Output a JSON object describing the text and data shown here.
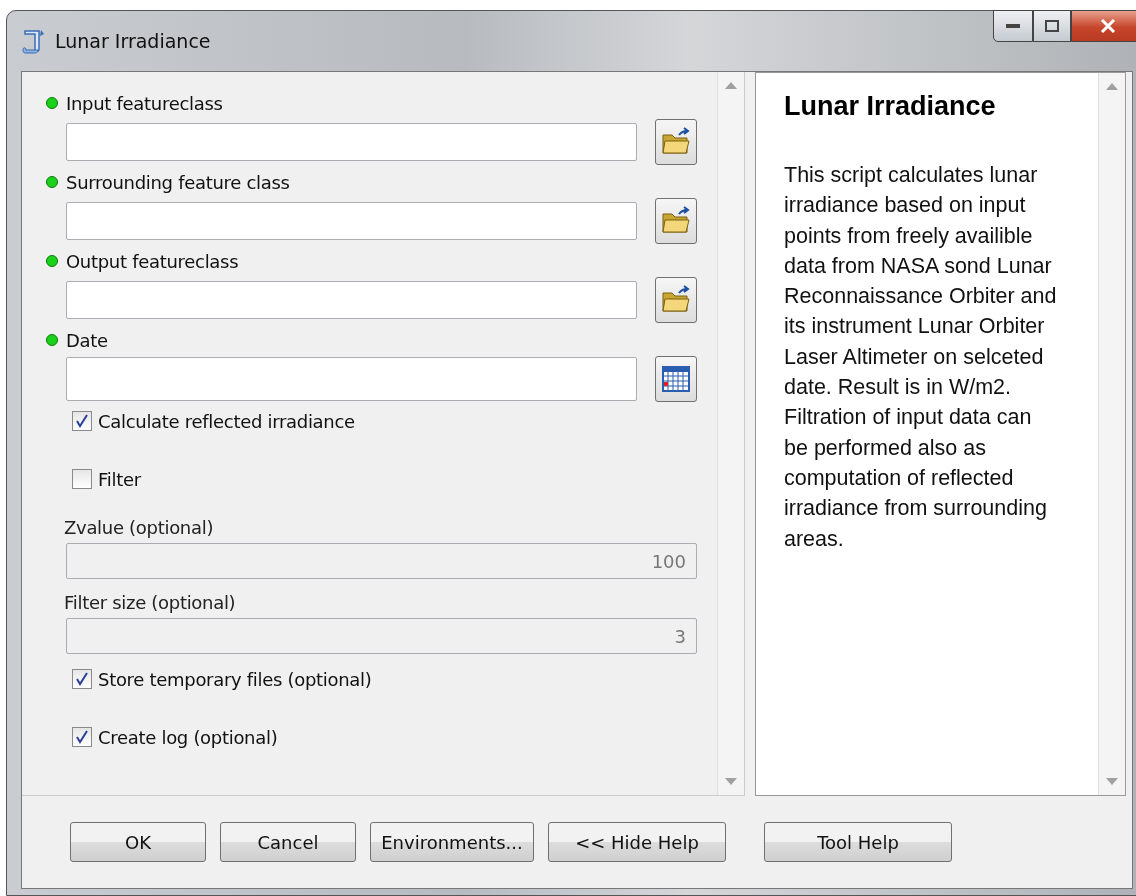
{
  "window": {
    "title": "Lunar Irradiance"
  },
  "parameters": [
    {
      "kind": "field",
      "label": "Input featureclass",
      "required": true,
      "button": {
        "kind": "folder"
      },
      "disabled": false
    },
    {
      "kind": "field",
      "label": "Surrounding feature class",
      "required": true,
      "button": {
        "kind": "folder"
      },
      "disabled": false
    },
    {
      "kind": "field",
      "label": "Output featureclass",
      "required": true,
      "button": {
        "kind": "folder"
      },
      "disabled": false
    },
    {
      "kind": "field",
      "label": "Date",
      "required": true,
      "button": {
        "kind": "calendar"
      },
      "disabled": false
    },
    {
      "kind": "checkbox",
      "label": "Calculate reflected irradiance",
      "checked": true
    },
    {
      "kind": "checkbox",
      "label": "Filter",
      "checked": false
    },
    {
      "kind": "field",
      "label": "Zvalue (optional)",
      "required": false,
      "value": "100",
      "disabled": true
    },
    {
      "kind": "field",
      "label": "Filter size (optional)",
      "required": false,
      "value": "3",
      "disabled": true
    },
    {
      "kind": "checkbox",
      "label": "Store temporary files (optional)",
      "checked": true
    },
    {
      "kind": "checkbox",
      "label": "Create log (optional)",
      "checked": true
    }
  ],
  "help": {
    "title": "Lunar Irradiance",
    "text": "This script calculates lunar irradiance based on input points from freely availible data from NASA sond Lunar Reconnaissance Orbiter and its instrument Lunar Orbiter Laser Altimeter on selceted date. Result is in W/m2. Filtration of input data can be performed also as computation of reflected irradiance from surrounding areas."
  },
  "buttons": [
    "OK",
    "Cancel",
    "Environments...",
    "<< Hide Help"
  ],
  "help_button": "Tool Help"
}
